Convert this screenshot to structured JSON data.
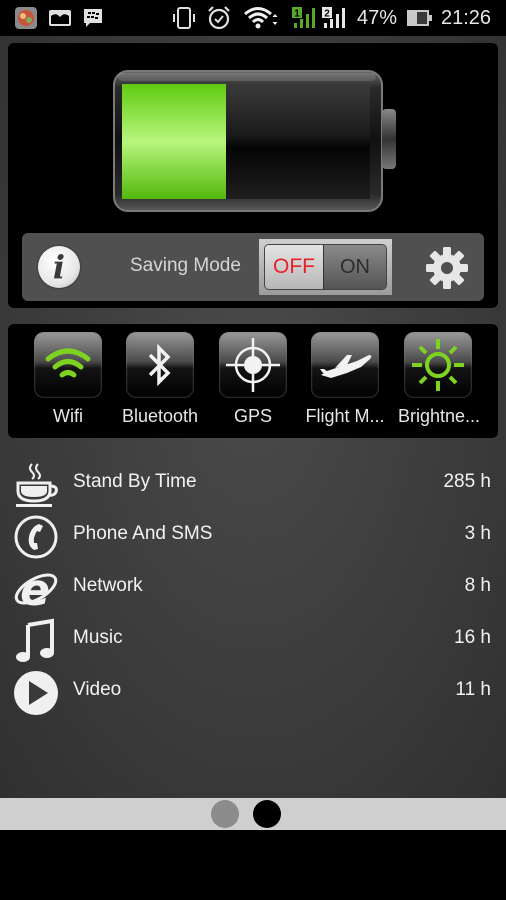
{
  "status_bar": {
    "notification_icons": [
      "app-icon",
      "gallery-icon",
      "bbm-icon"
    ],
    "system_icons": [
      "vibrate-icon",
      "alarm-icon",
      "wifi-icon",
      "sim1-signal-icon",
      "sim2-signal-icon"
    ],
    "sim1_label": "1",
    "sim2_label": "2",
    "battery_percent": "47%",
    "time": "21:26"
  },
  "battery": {
    "level_fraction": 0.42,
    "fill_color": "#6fd21c"
  },
  "controls": {
    "info_label": "i",
    "saving_mode_label": "Saving Mode",
    "switch_off_label": "OFF",
    "switch_on_label": "ON",
    "saving_mode_state": "OFF"
  },
  "toggles": [
    {
      "label": "Wifi",
      "icon": "wifi-icon",
      "active": true
    },
    {
      "label": "Bluetooth",
      "icon": "bluetooth-icon",
      "active": false
    },
    {
      "label": "GPS",
      "icon": "gps-icon",
      "active": false
    },
    {
      "label": "Flight M...",
      "icon": "airplane-icon",
      "active": false
    },
    {
      "label": "Brightne...",
      "icon": "brightness-icon",
      "active": true
    }
  ],
  "usage": [
    {
      "label": "Stand By Time",
      "value": "285 h",
      "icon": "coffee-cup-icon"
    },
    {
      "label": "Phone And SMS",
      "value": "3 h",
      "icon": "phone-icon"
    },
    {
      "label": "Network",
      "value": "8 h",
      "icon": "internet-explorer-icon"
    },
    {
      "label": "Music",
      "value": "16 h",
      "icon": "music-note-icon"
    },
    {
      "label": "Video",
      "value": "11 h",
      "icon": "play-icon"
    }
  ],
  "pager": {
    "pages": 2,
    "current_page": 2
  },
  "colors": {
    "accent_green": "#6fd21c",
    "switch_off_red": "#e8202b"
  }
}
